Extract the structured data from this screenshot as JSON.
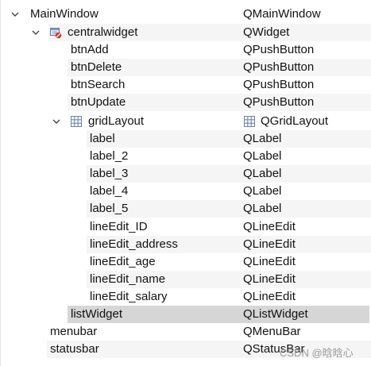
{
  "rows": [
    {
      "name": "MainWindow",
      "class": "QMainWindow"
    },
    {
      "name": "centralwidget",
      "class": "QWidget"
    },
    {
      "name": "btnAdd",
      "class": "QPushButton"
    },
    {
      "name": "btnDelete",
      "class": "QPushButton"
    },
    {
      "name": "btnSearch",
      "class": "QPushButton"
    },
    {
      "name": "btnUpdate",
      "class": "QPushButton"
    },
    {
      "name": "gridLayout",
      "class": "QGridLayout"
    },
    {
      "name": "label",
      "class": "QLabel"
    },
    {
      "name": "label_2",
      "class": "QLabel"
    },
    {
      "name": "label_3",
      "class": "QLabel"
    },
    {
      "name": "label_4",
      "class": "QLabel"
    },
    {
      "name": "label_5",
      "class": "QLabel"
    },
    {
      "name": "lineEdit_ID",
      "class": "QLineEdit"
    },
    {
      "name": "lineEdit_address",
      "class": "QLineEdit"
    },
    {
      "name": "lineEdit_age",
      "class": "QLineEdit"
    },
    {
      "name": "lineEdit_name",
      "class": "QLineEdit"
    },
    {
      "name": "lineEdit_salary",
      "class": "QLineEdit"
    },
    {
      "name": "listWidget",
      "class": "QListWidget",
      "selected": true
    },
    {
      "name": "menubar",
      "class": "QMenuBar"
    },
    {
      "name": "statusbar",
      "class": "QStatusBar"
    }
  ],
  "icons": {
    "expand": "chevron-down-icon",
    "widget": "widget-broken-layout-icon",
    "layout": "grid-layout-icon"
  },
  "colors": {
    "row_alt": "#f5f5f5",
    "row_selected": "#d6d6d6",
    "text": "#111111"
  },
  "watermark": "CSDN @晗晗心"
}
